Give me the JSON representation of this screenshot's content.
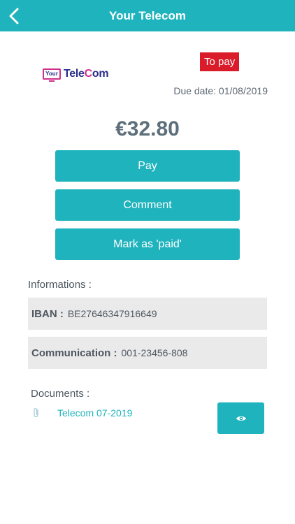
{
  "header": {
    "title": "Your Telecom",
    "back_icon": "chevron-left-icon"
  },
  "logo": {
    "box_text": "Your",
    "word_main": "Tele",
    "word_accent": "C",
    "word_end": "om"
  },
  "bill": {
    "status": "To pay",
    "due_label": "Due date: 01/08/2019",
    "amount": "€32.80"
  },
  "actions": {
    "pay": "Pay",
    "comment": "Comment",
    "mark_paid": "Mark as 'paid'"
  },
  "informations": {
    "label": "Informations :",
    "iban_key": "IBAN :",
    "iban_value": "BE27646347916649",
    "comm_key": "Communication :",
    "comm_value": "001-23456-808"
  },
  "documents": {
    "label": "Documents :",
    "items": [
      {
        "name": "Telecom 07-2019",
        "icon": "paperclip-icon"
      }
    ],
    "view_icon": "eye-icon"
  },
  "colors": {
    "accent": "#1fb3bd",
    "status_red": "#d91b2a",
    "panel_gray": "#eaeaea"
  }
}
